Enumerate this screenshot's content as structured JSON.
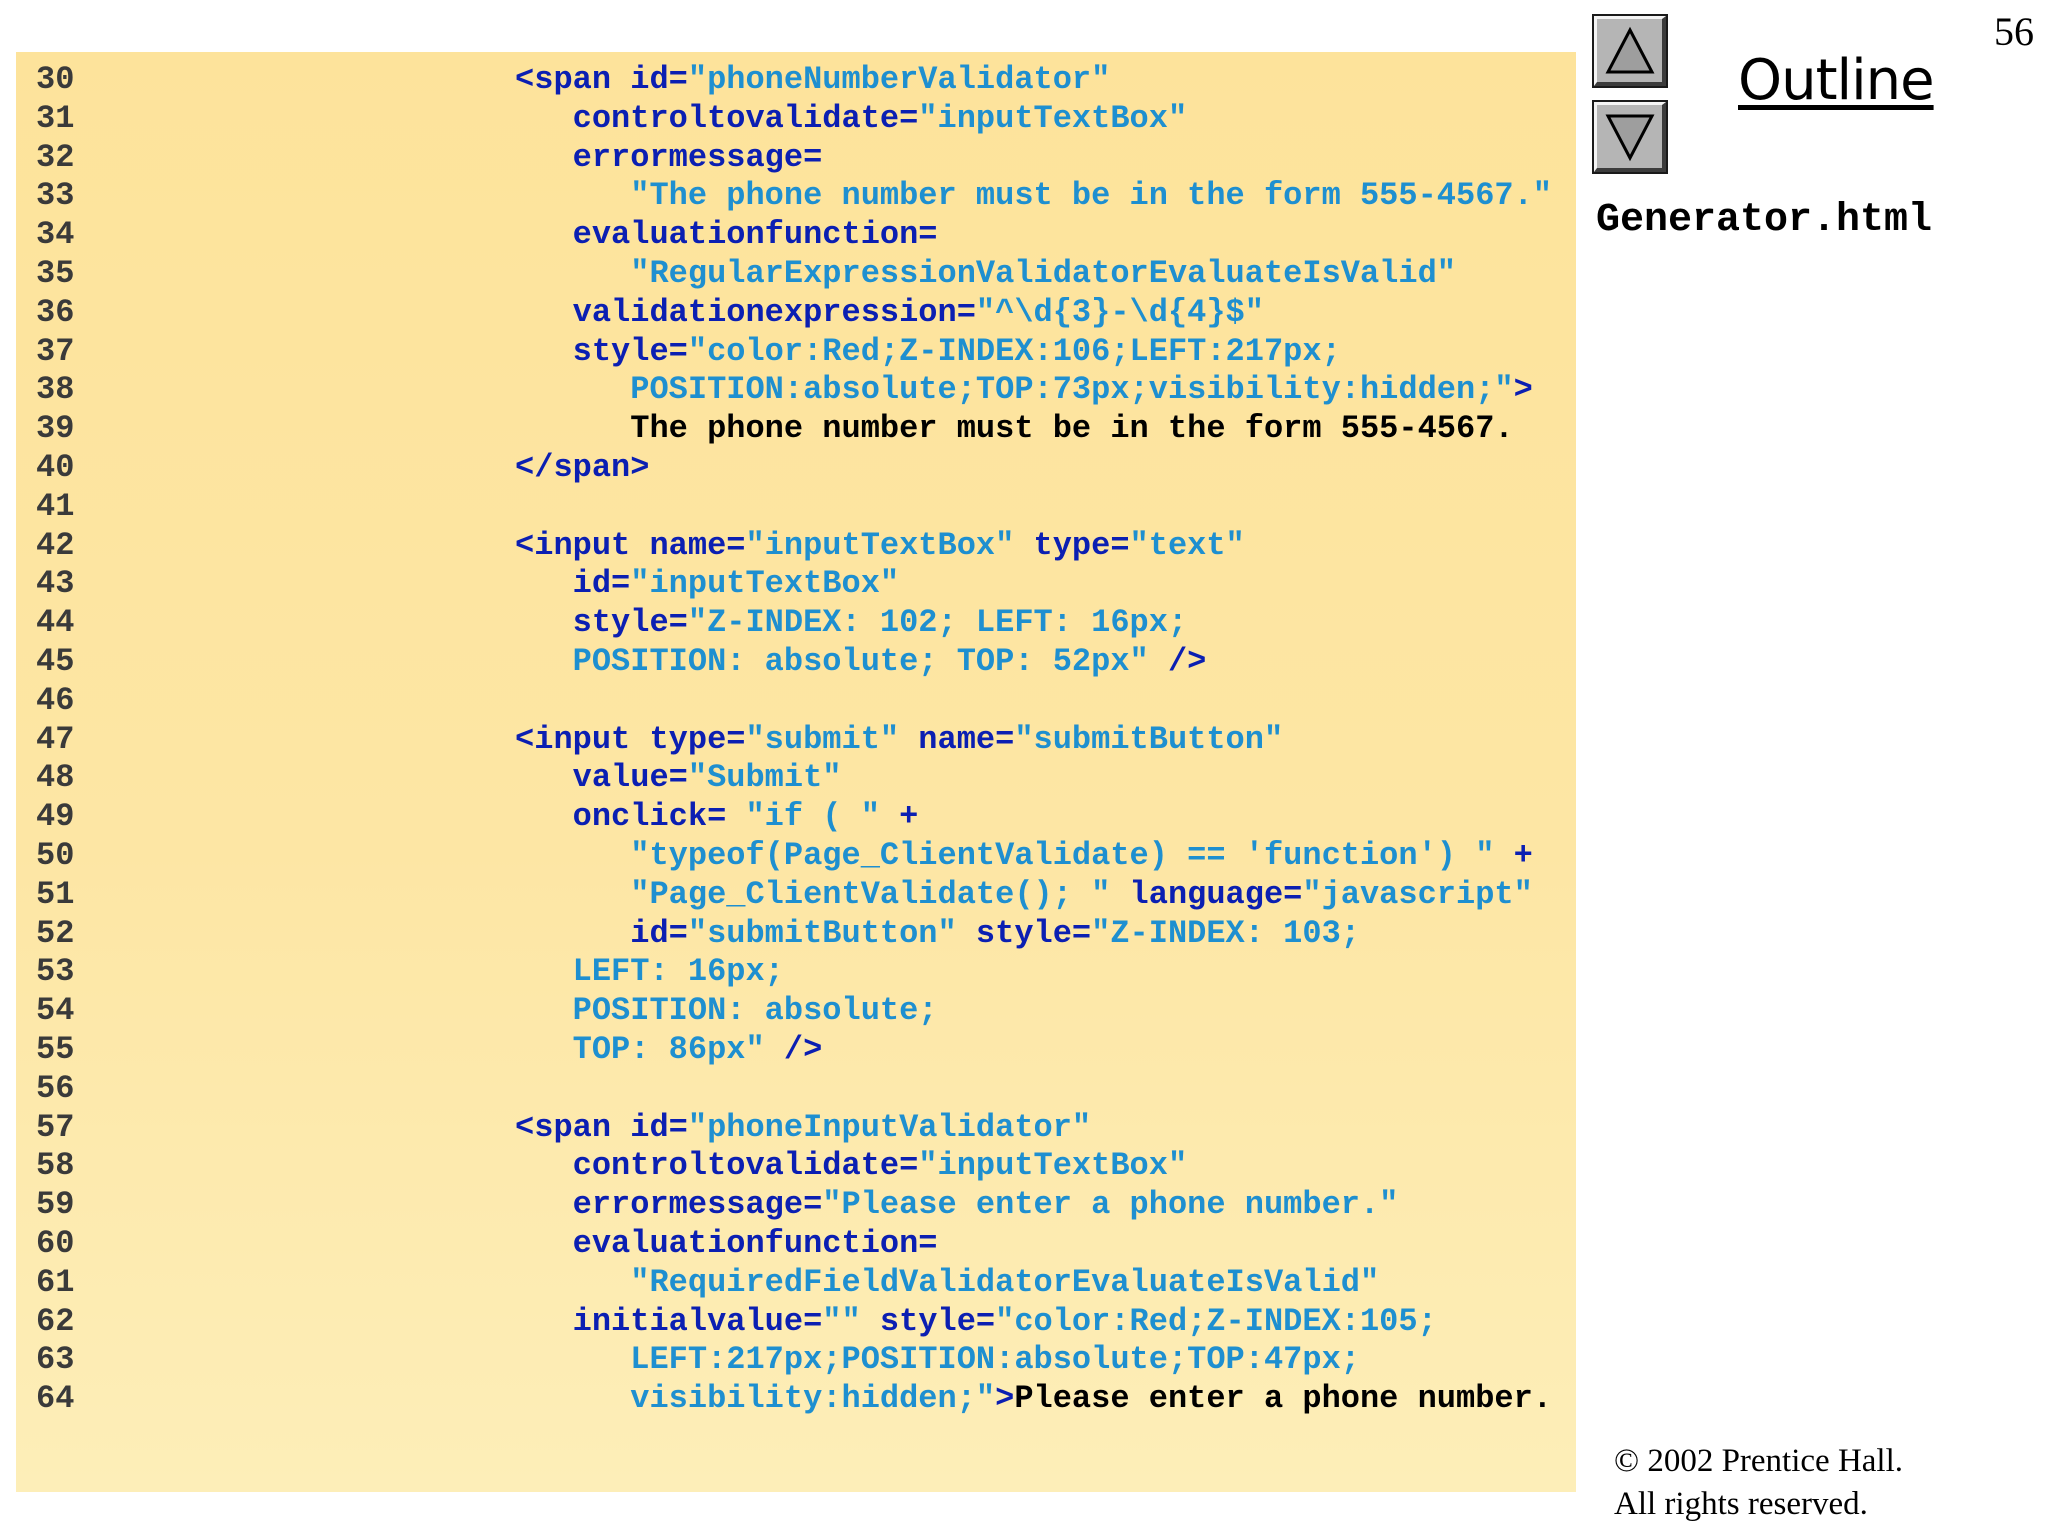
{
  "page_number": "56",
  "sidebar": {
    "outline_label": "Outline",
    "filename": "Generator.html",
    "nav": {
      "up": "up-arrow-icon",
      "down": "down-arrow-icon"
    }
  },
  "copyright": {
    "line1": "© 2002 Prentice Hall.",
    "line2": "All rights reserved."
  },
  "colors": {
    "keyword": "#0b1fb2",
    "string": "#1e8fd0",
    "text": "#000000",
    "panel": "#fde39b"
  },
  "code_lines": [
    {
      "n": "30",
      "parts": [
        [
          "k",
          "          <span id="
        ],
        [
          "s",
          "\"phoneNumberValidator\""
        ]
      ]
    },
    {
      "n": "31",
      "parts": [
        [
          "k",
          "             controltovalidate="
        ],
        [
          "s",
          "\"inputTextBox\""
        ]
      ]
    },
    {
      "n": "32",
      "parts": [
        [
          "k",
          "             errormessage="
        ]
      ]
    },
    {
      "n": "33",
      "parts": [
        [
          "s",
          "                \"The phone number must be in the form 555-4567.\""
        ]
      ]
    },
    {
      "n": "34",
      "parts": [
        [
          "k",
          "             evaluationfunction="
        ]
      ]
    },
    {
      "n": "35",
      "parts": [
        [
          "s",
          "                \"RegularExpressionValidatorEvaluateIsValid\""
        ]
      ]
    },
    {
      "n": "36",
      "parts": [
        [
          "k",
          "             validationexpression="
        ],
        [
          "s",
          "\"^\\d{3}-\\d{4}$\""
        ]
      ]
    },
    {
      "n": "37",
      "parts": [
        [
          "k",
          "             style="
        ],
        [
          "s",
          "\"color:Red;Z-INDEX:106;LEFT:217px;"
        ]
      ]
    },
    {
      "n": "38",
      "parts": [
        [
          "s",
          "                POSITION:absolute;TOP:73px;visibility:hidden;\""
        ],
        [
          "k",
          ">"
        ]
      ]
    },
    {
      "n": "39",
      "parts": [
        [
          "t",
          "                The phone number must be in the form 555-4567."
        ]
      ]
    },
    {
      "n": "40",
      "parts": [
        [
          "k",
          "          </span>"
        ]
      ]
    },
    {
      "n": "41",
      "parts": []
    },
    {
      "n": "42",
      "parts": [
        [
          "k",
          "          <input name="
        ],
        [
          "s",
          "\"inputTextBox\""
        ],
        [
          "k",
          " type="
        ],
        [
          "s",
          "\"text\""
        ]
      ]
    },
    {
      "n": "43",
      "parts": [
        [
          "k",
          "             id="
        ],
        [
          "s",
          "\"inputTextBox\""
        ]
      ]
    },
    {
      "n": "44",
      "parts": [
        [
          "k",
          "             style="
        ],
        [
          "s",
          "\"Z-INDEX: 102; LEFT: 16px;"
        ]
      ]
    },
    {
      "n": "45",
      "parts": [
        [
          "s",
          "             POSITION: absolute; TOP: 52px\""
        ],
        [
          "k",
          " />"
        ]
      ]
    },
    {
      "n": "46",
      "parts": []
    },
    {
      "n": "47",
      "parts": [
        [
          "k",
          "          <input type="
        ],
        [
          "s",
          "\"submit\""
        ],
        [
          "k",
          " name="
        ],
        [
          "s",
          "\"submitButton\""
        ]
      ]
    },
    {
      "n": "48",
      "parts": [
        [
          "k",
          "             value="
        ],
        [
          "s",
          "\"Submit\""
        ]
      ]
    },
    {
      "n": "49",
      "parts": [
        [
          "k",
          "             onclick= "
        ],
        [
          "s",
          "\"if ( \""
        ],
        [
          "k",
          " +"
        ]
      ]
    },
    {
      "n": "50",
      "parts": [
        [
          "s",
          "                \"typeof(Page_ClientValidate) == 'function') \""
        ],
        [
          "k",
          " +"
        ]
      ]
    },
    {
      "n": "51",
      "parts": [
        [
          "s",
          "                \"Page_ClientValidate(); \""
        ],
        [
          "k",
          " language="
        ],
        [
          "s",
          "\"javascript\""
        ]
      ]
    },
    {
      "n": "52",
      "parts": [
        [
          "k",
          "                id="
        ],
        [
          "s",
          "\"submitButton\""
        ],
        [
          "k",
          " style="
        ],
        [
          "s",
          "\"Z-INDEX: 103;"
        ]
      ]
    },
    {
      "n": "53",
      "parts": [
        [
          "s",
          "             LEFT: 16px;"
        ]
      ]
    },
    {
      "n": "54",
      "parts": [
        [
          "s",
          "             POSITION: absolute;"
        ]
      ]
    },
    {
      "n": "55",
      "parts": [
        [
          "s",
          "             TOP: 86px\""
        ],
        [
          "k",
          " />"
        ]
      ]
    },
    {
      "n": "56",
      "parts": []
    },
    {
      "n": "57",
      "parts": [
        [
          "k",
          "          <span id="
        ],
        [
          "s",
          "\"phoneInputValidator\""
        ]
      ]
    },
    {
      "n": "58",
      "parts": [
        [
          "k",
          "             controltovalidate="
        ],
        [
          "s",
          "\"inputTextBox\""
        ]
      ]
    },
    {
      "n": "59",
      "parts": [
        [
          "k",
          "             errormessage="
        ],
        [
          "s",
          "\"Please enter a phone number.\""
        ]
      ]
    },
    {
      "n": "60",
      "parts": [
        [
          "k",
          "             evaluationfunction="
        ]
      ]
    },
    {
      "n": "61",
      "parts": [
        [
          "s",
          "                \"RequiredFieldValidatorEvaluateIsValid\""
        ]
      ]
    },
    {
      "n": "62",
      "parts": [
        [
          "k",
          "             initialvalue="
        ],
        [
          "s",
          "\"\""
        ],
        [
          "k",
          " style="
        ],
        [
          "s",
          "\"color:Red;Z-INDEX:105;"
        ]
      ]
    },
    {
      "n": "63",
      "parts": [
        [
          "s",
          "                LEFT:217px;POSITION:absolute;TOP:47px;"
        ]
      ]
    },
    {
      "n": "64",
      "parts": [
        [
          "s",
          "                visibility:hidden;\""
        ],
        [
          "k",
          ">"
        ],
        [
          "t",
          "Please enter a phone number."
        ]
      ]
    }
  ]
}
